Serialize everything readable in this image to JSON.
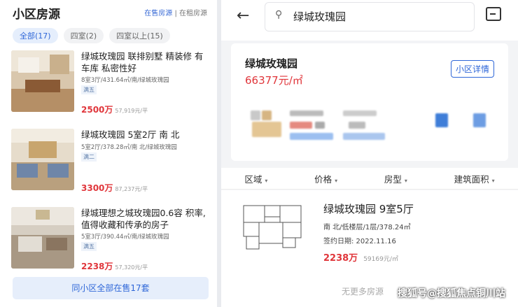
{
  "left": {
    "title": "小区房源",
    "link_sale": "在售房源",
    "link_sep": "|",
    "link_rent": "在租房源",
    "tabs": [
      "全部(17)",
      "四室(2)",
      "四室以上(15)"
    ],
    "listings": [
      {
        "title": "绿城玫瑰园 联排别墅 精装修 有车库 私密性好",
        "sub": "8室3厅/431.64㎡/南/绿城玫瑰园",
        "tag": "满五",
        "price": "2500万",
        "unit": "57,919元/平"
      },
      {
        "title": "绿城玫瑰园 5室2厅 南 北",
        "sub": "5室2厅/378.28㎡/南 北/绿城玫瑰园",
        "tag": "满二",
        "price": "3300万",
        "unit": "87,237元/平"
      },
      {
        "title": "绿城理想之城玫瑰园0.6容 积率,值得收藏和传承的房子",
        "sub": "5室3厅/390.44㎡/南/绿城玫瑰园",
        "tag": "满五",
        "price": "2238万",
        "unit": "57,320元/平"
      }
    ],
    "all_button": "同小区全部在售17套"
  },
  "right": {
    "search_value": "绿城玫瑰园",
    "card_name": "绿城玫瑰园",
    "card_price": "66377元/㎡",
    "detail_button": "小区详情",
    "filters": [
      "区域",
      "价格",
      "房型",
      "建筑面积"
    ],
    "result": {
      "title": "绿城玫瑰园 9室5厅",
      "sub": "南 北/低楼层/1层/378.24㎡",
      "date": "签约日期: 2022.11.16",
      "price": "2238万",
      "unit": "59169元/㎡"
    },
    "no_more": "无更多房源"
  },
  "watermark": "搜狐号@搜狐焦点铜川站",
  "icons": {
    "back": "arrow-left-icon",
    "search": "search-icon",
    "message": "message-icon",
    "chevron": "chevron-down-icon"
  },
  "colors": {
    "accent": "#2f67d8",
    "price": "#e0363b"
  }
}
